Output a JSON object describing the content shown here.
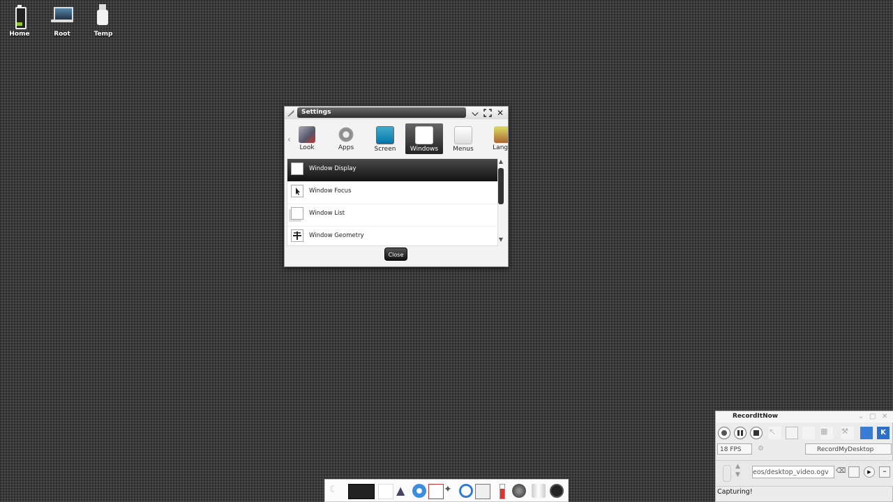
{
  "desktop": {
    "icons": [
      {
        "label": "Home",
        "icon": "battery-home-icon"
      },
      {
        "label": "Root",
        "icon": "laptop-icon"
      },
      {
        "label": "Temp",
        "icon": "usb-drive-icon"
      }
    ]
  },
  "settings": {
    "title": "Settings",
    "tabs": [
      {
        "label": "Look",
        "icon": "look-icon"
      },
      {
        "label": "Apps",
        "icon": "gear-icon"
      },
      {
        "label": "Screen",
        "icon": "monitor-icon"
      },
      {
        "label": "Windows",
        "icon": "window-icon",
        "active": true
      },
      {
        "label": "Menus",
        "icon": "menu-icon"
      },
      {
        "label": "Langu",
        "icon": "language-icon"
      }
    ],
    "items": [
      {
        "label": "Window Display",
        "selected": true
      },
      {
        "label": "Window Focus"
      },
      {
        "label": "Window List"
      },
      {
        "label": "Window Geometry"
      }
    ],
    "close_label": "Close"
  },
  "recorder": {
    "title": "RecordItNow",
    "fps": "18 FPS",
    "backend": "RecordMyDesktop",
    "output_path": "eos/desktop_video.ogv",
    "status": "Capturing!"
  },
  "colors": {
    "accent_dark": "#1e1e1e",
    "selection": "#2a2a2a"
  }
}
